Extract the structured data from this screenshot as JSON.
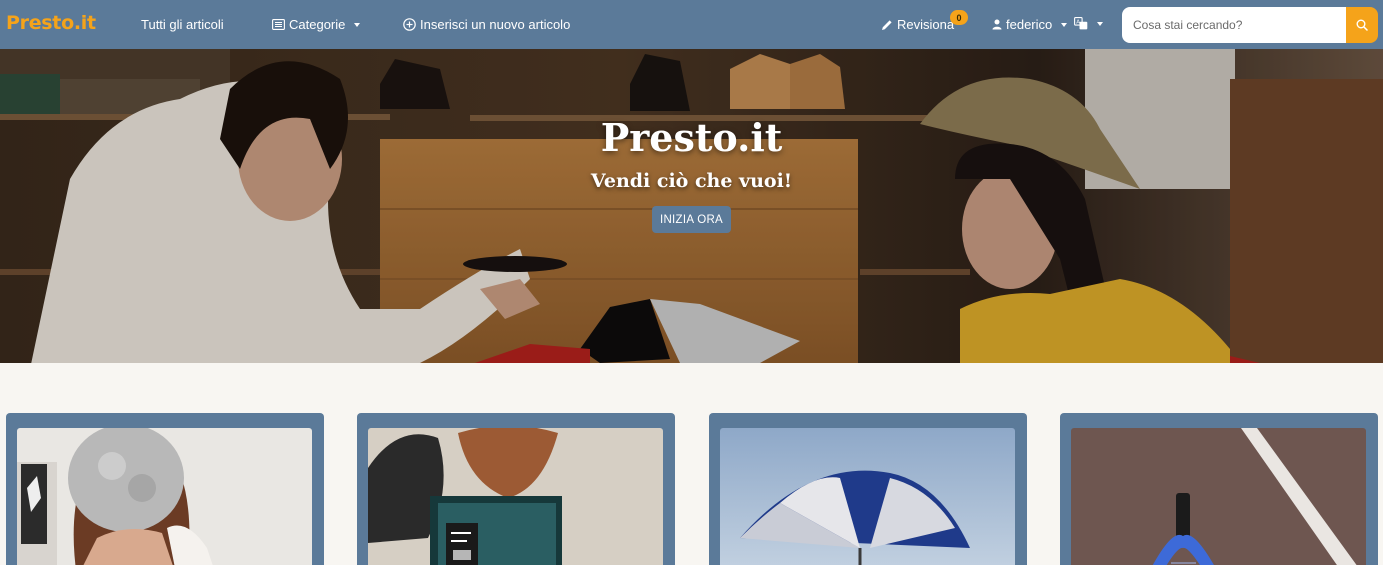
{
  "brand": "Presto.it",
  "nav": {
    "all_articles": "Tutti gli articoli",
    "categories": "Categorie",
    "new_article": "Inserisci un nuovo articolo",
    "review": "Revisiona",
    "review_count": "0",
    "user": "federico"
  },
  "search": {
    "placeholder": "Cosa stai cercando?"
  },
  "hero": {
    "title": "Presto.it",
    "subtitle": "Vendi ciò che vuoi!",
    "cta": "INIZIA ORA"
  },
  "colors": {
    "navbar": "#5b7a99",
    "accent": "#f5a31a",
    "background": "#f8f6f2"
  },
  "icons": {
    "categories": "list-icon",
    "new_article": "plus-circle-icon",
    "review": "pencil-icon",
    "user": "user-icon",
    "language": "translate-icon",
    "search": "search-icon"
  },
  "cards": [
    {
      "image": "woman-in-white-top-photo"
    },
    {
      "image": "hats-on-wall-photo"
    },
    {
      "image": "umbrella-sky-photo"
    },
    {
      "image": "tennis-racket-court-photo"
    }
  ]
}
